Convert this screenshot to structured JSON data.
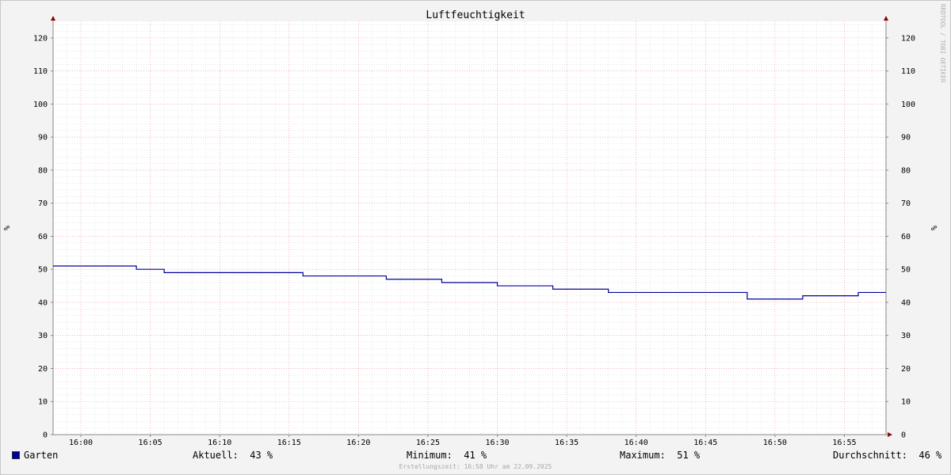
{
  "chart_data": {
    "type": "line",
    "title": "Luftfeuchtigkeit",
    "ylabel": "%",
    "y2label": "%",
    "ylim": [
      0,
      125
    ],
    "y_ticks": [
      0,
      10,
      20,
      30,
      40,
      50,
      60,
      70,
      80,
      90,
      100,
      110,
      120
    ],
    "xlim": [
      "15:58",
      "16:58"
    ],
    "x_ticks": [
      "16:00",
      "16:05",
      "16:10",
      "16:15",
      "16:20",
      "16:25",
      "16:30",
      "16:35",
      "16:40",
      "16:45",
      "16:50",
      "16:55"
    ],
    "grid": true,
    "step": true,
    "series": [
      {
        "name": "Garten",
        "color": "#000099",
        "points": [
          {
            "x": "15:58",
            "y": 51
          },
          {
            "x": "16:04",
            "y": 50
          },
          {
            "x": "16:06",
            "y": 49
          },
          {
            "x": "16:16",
            "y": 48
          },
          {
            "x": "16:22",
            "y": 47
          },
          {
            "x": "16:26",
            "y": 46
          },
          {
            "x": "16:30",
            "y": 45
          },
          {
            "x": "16:34",
            "y": 44
          },
          {
            "x": "16:38",
            "y": 43
          },
          {
            "x": "16:48",
            "y": 41
          },
          {
            "x": "16:52",
            "y": 42
          },
          {
            "x": "16:56",
            "y": 43
          },
          {
            "x": "16:58",
            "y": 43
          }
        ]
      }
    ]
  },
  "legend": {
    "series_name": "Garten",
    "current": "Aktuell:  43 %",
    "minimum": "Minimum:  41 %",
    "maximum": "Maximum:  51 %",
    "average": "Durchschnitt:  46 %"
  },
  "watermark": "RRDTOOL / TOBI OETIKER",
  "footer": "Erstellungszeit: 16:58 Uhr am 22.09.2025"
}
